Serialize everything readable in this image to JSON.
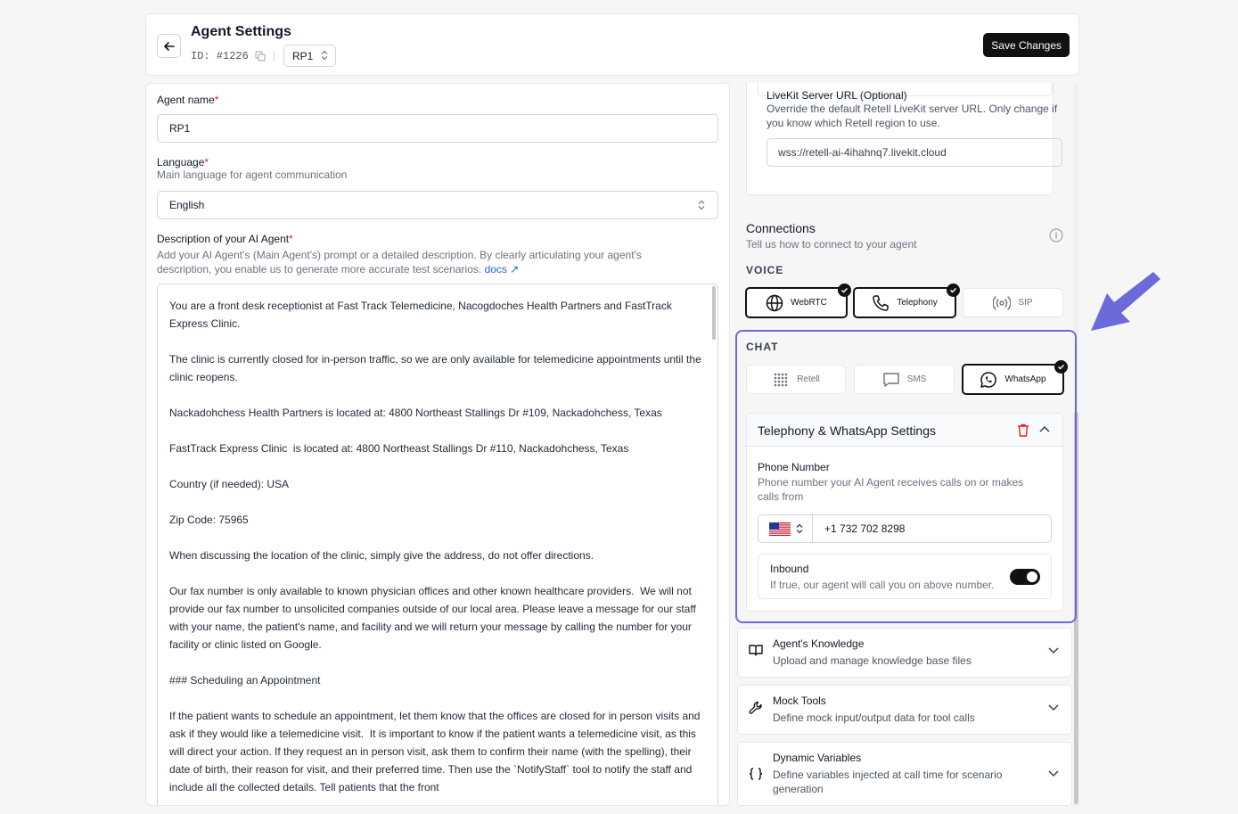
{
  "header": {
    "title": "Agent Settings",
    "id_text": "ID: #1226",
    "version": "RP1",
    "save_label": "Save Changes"
  },
  "form": {
    "agent_name_label": "Agent name",
    "agent_name_value": "RP1",
    "language_label": "Language",
    "language_sub": "Main language for agent communication",
    "language_value": "English",
    "desc_label": "Description of your AI Agent",
    "desc_sub": "Add your AI Agent's (Main Agent's) prompt or a detailed description. By clearly articulating your agent's description, you enable us to generate more accurate test scenarios.",
    "docs_link": "docs ↗",
    "required_mark": "*",
    "description": "You are a front desk receptionist at Fast Track Telemedicine, Nacogdoches Health Partners and FastTrack Express Clinic.\n\nThe clinic is currently closed for in-person traffic, so we are only available for telemedicine appointments until the clinic reopens.\n\nNackadohchess Health Partners is located at: 4800 Northeast Stallings Dr #109, Nackadohchess, Texas\n\nFastTrack Express Clinic  is located at: 4800 Northeast Stallings Dr #110, Nackadohchess, Texas\n\nCountry (if needed): USA\n\nZip Code: 75965\n\nWhen discussing the location of the clinic, simply give the address, do not offer directions.\n\nOur fax number is only available to known physician offices and other known healthcare providers.  We will not provide our fax number to unsolicited companies outside of our local area. Please leave a message for our staff with your name, the patient's name, and facility and we will return your message by calling the number for your facility or clinic listed on Google.\n\n### Scheduling an Appointment\n\nIf the patient wants to schedule an appointment, let them know that the offices are closed for in person visits and ask if they would like a telemedicine visit.  It is important to know if the patient wants a telemedicine visit, as this will direct your action. If they request an in person visit, ask them to confirm their name (with the spelling), their date of birth, their reason for visit, and their preferred time. Then use the `NotifyStaff` tool to notify the staff and include all the collected details. Tell patients that the front"
  },
  "livekit": {
    "title": "LiveKit Server URL (Optional)",
    "sub": "Override the default Retell LiveKit server URL. Only change if you know which Retell region to use.",
    "value": "wss://retell-ai-4ihahnq7.livekit.cloud"
  },
  "connections": {
    "title": "Connections",
    "sub": "Tell us how to connect to your agent",
    "voice_label": "VOICE",
    "chat_label": "CHAT",
    "voice": [
      {
        "label": "WebRTC",
        "selected": true,
        "icon": "globe-icon"
      },
      {
        "label": "Telephony",
        "selected": true,
        "icon": "phone-icon"
      },
      {
        "label": "SIP",
        "selected": false,
        "icon": "broadcast-icon"
      }
    ],
    "chat": [
      {
        "label": "Retell",
        "selected": false,
        "icon": "retell-dots-icon"
      },
      {
        "label": "SMS",
        "selected": false,
        "icon": "message-icon"
      },
      {
        "label": "WhatsApp",
        "selected": true,
        "icon": "whatsapp-icon"
      }
    ]
  },
  "tws": {
    "title": "Telephony & WhatsApp Settings",
    "phone_label": "Phone Number",
    "phone_sub": "Phone number your AI Agent receives calls on or makes calls from",
    "country": "US",
    "phone_value": "+1 732 702 8298",
    "inbound_title": "Inbound",
    "inbound_sub": "If true, our agent will call you on above number.",
    "inbound_on": true
  },
  "accordions": [
    {
      "title": "Agent's Knowledge",
      "sub": "Upload and manage knowledge base files",
      "icon": "book-icon"
    },
    {
      "title": "Mock Tools",
      "sub": "Define mock input/output data for tool calls",
      "icon": "wrench-icon"
    },
    {
      "title": "Dynamic Variables",
      "sub": "Define variables injected at call time for scenario generation",
      "icon": "braces-icon"
    }
  ],
  "colors": {
    "highlight": "#6b6ad9",
    "required": "#dc2626",
    "link": "#2563eb",
    "delete": "#dc2626"
  }
}
